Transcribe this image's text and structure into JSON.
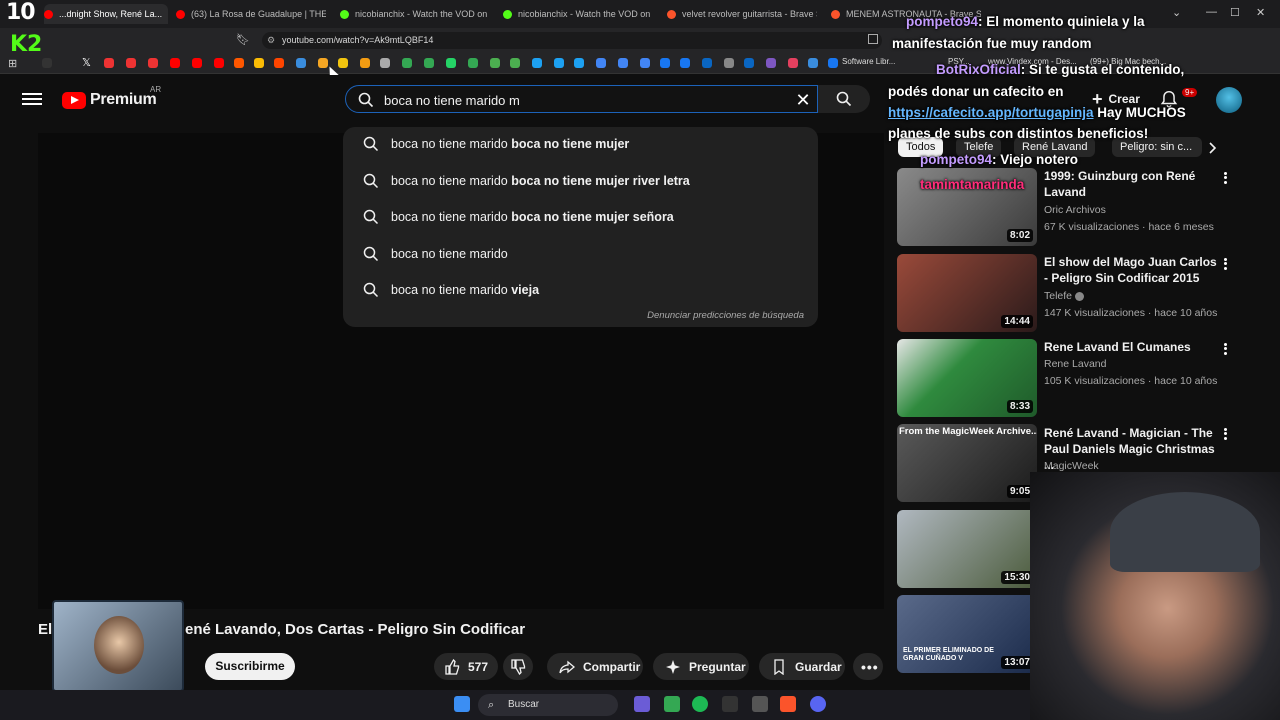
{
  "browser": {
    "tabs": [
      {
        "label": "...dnight Show, René La...",
        "color": "#ff0000",
        "active": true
      },
      {
        "label": "(63) La Rosa de Guadalupe | THERIAN",
        "color": "#ff0000"
      },
      {
        "label": "nicobianchix - Watch the VOD on Ki...",
        "color": "#53fc18"
      },
      {
        "label": "nicobianchix - Watch the VOD on Ki...",
        "color": "#53fc18"
      },
      {
        "label": "velvet revolver guitarrista - Brave Se...",
        "color": "#fb542b"
      },
      {
        "label": "MENEM ASTRONAUTA - Brave Search",
        "color": "#fb542b"
      }
    ],
    "url": "youtube.com/watch?v=Ak9mtLQBF14",
    "bookmark_colors": [
      "#e33",
      "#e33",
      "#e33",
      "#fbbc05",
      "#ff0000",
      "#4caf50",
      "#1da1f2",
      "#ff5700",
      "#00a884",
      "#25d366",
      "#34a853",
      "#1da1f2",
      "#4285f4",
      "#1877f2",
      "#0a66c2",
      "#e4405f",
      "#ff0000",
      "#1877f2"
    ],
    "bookmark_items": [
      "Software Libr...",
      "PSY...",
      "www.Vindex.com - Des...",
      "(99+) Big Mac bech..."
    ]
  },
  "overlay": {
    "counter": "10",
    "kick_logo": "K2"
  },
  "header": {
    "logo_text": "Premium",
    "country_code": "AR",
    "search_value": "boca no tiene marido m",
    "create_label": "Crear",
    "notif_count": "9+"
  },
  "suggestions": [
    {
      "typed": "boca no tiene marido ",
      "rest": "boca no tiene mujer"
    },
    {
      "typed": "boca no tiene marido ",
      "rest": "boca no tiene mujer river letra"
    },
    {
      "typed": "boca no tiene marido ",
      "rest": "boca no tiene mujer señora"
    },
    {
      "typed": "boca no tiene marido",
      "rest": ""
    },
    {
      "typed": "boca no tiene marido ",
      "rest": "vieja"
    }
  ],
  "report_predictions": "Denunciar predicciones de búsqueda",
  "video": {
    "title_prefix": "El",
    "title": "ené Lavando, Dos Cartas - Peligro Sin Codificar",
    "subscribe": "Suscribirme",
    "likes": "577",
    "share": "Compartir",
    "ask": "Preguntar",
    "save": "Guardar"
  },
  "chat": [
    {
      "user": "pompeto94",
      "text": ": El momento quiniela y la"
    },
    {
      "user": "",
      "text": "manifestación fue muy random"
    },
    {
      "user": "BotRixOficial",
      "text": ": Si te gusta el contenido,"
    },
    {
      "user": "",
      "text": "podés donar un cafecito en"
    },
    {
      "user": "",
      "link": "https://cafecito.app/tortugapinja",
      "text": " Hay MUCHOS"
    },
    {
      "user": "",
      "text": "planes de subs con distintos beneficios!"
    },
    {
      "user": "pompeto94",
      "text": ": Viejo notero"
    },
    {
      "user": "tamimtamarinda",
      "text": ""
    }
  ],
  "chips": [
    {
      "label": "Todos",
      "selected": true
    },
    {
      "label": "Telefe"
    },
    {
      "label": "René Lavand"
    },
    {
      "label": "Peligro: sin c..."
    }
  ],
  "recommendations": [
    {
      "title": "1999: Guinzburg con René Lavand",
      "channel": "Oric Archivos",
      "meta": "67 K visualizaciones · hace 6 meses",
      "duration": "8:02",
      "thumb_color": "#6b6b6b"
    },
    {
      "title": "El show del Mago Juan Carlos - Peligro Sin Codificar 2015",
      "channel": "Telefe",
      "meta": "147 K visualizaciones · hace 10 años",
      "duration": "14:44",
      "thumb_color": "#7a3a2e"
    },
    {
      "title": "Rene Lavand El Cumanes",
      "channel": "Rene Lavand",
      "meta": "105 K visualizaciones · hace 10 años",
      "duration": "8:33",
      "thumb_color": "#2f7a3a"
    },
    {
      "title": "René Lavand - Magician - The Paul Daniels Magic Christmas ...",
      "channel": "MagicWeek",
      "meta": "",
      "duration": "9:05",
      "thumb_color": "#4a4a4a",
      "thumb_caption": "From the MagicWeek Archive..."
    },
    {
      "title": "",
      "channel": "",
      "meta": "",
      "duration": "15:30",
      "thumb_color": "#6d7b8a"
    },
    {
      "title": "",
      "channel": "",
      "meta": "",
      "duration": "13:07",
      "thumb_color": "#3a4a6a",
      "thumb_caption": "EL PRIMER ELIMINADO DE GRAN CUÑADO V"
    }
  ],
  "taskbar": {
    "search_label": "Buscar"
  }
}
